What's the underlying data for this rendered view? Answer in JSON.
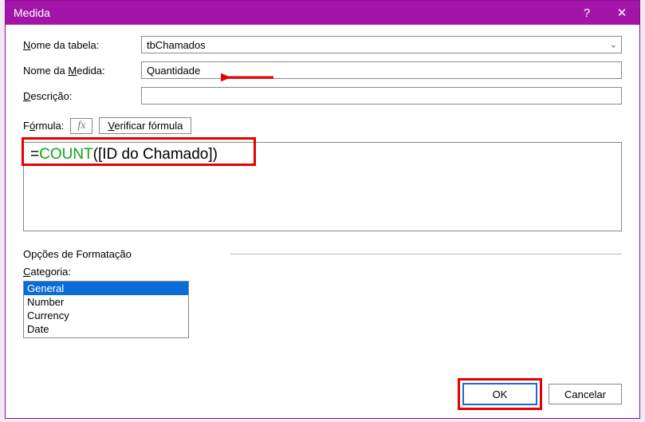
{
  "titlebar": {
    "title": "Medida",
    "help_label": "?",
    "close_label": "✕"
  },
  "form": {
    "table_label": "Nome da tabela:",
    "table_value": "tbChamados",
    "measure_label": "Nome da Medida:",
    "measure_value": "Quantidade",
    "description_label": "Descrição:",
    "description_value": ""
  },
  "formula": {
    "label": "Fórmula:",
    "fx": "fx",
    "verify_label": "Verificar fórmula",
    "content_eq": "=",
    "content_fn": "COUNT",
    "content_rest": "([ID do Chamado])"
  },
  "formatting": {
    "section_label": "Opções de Formatação",
    "category_label": "Categoria:",
    "items": [
      "General",
      "Number",
      "Currency",
      "Date"
    ]
  },
  "buttons": {
    "ok": "OK",
    "cancel": "Cancelar"
  }
}
